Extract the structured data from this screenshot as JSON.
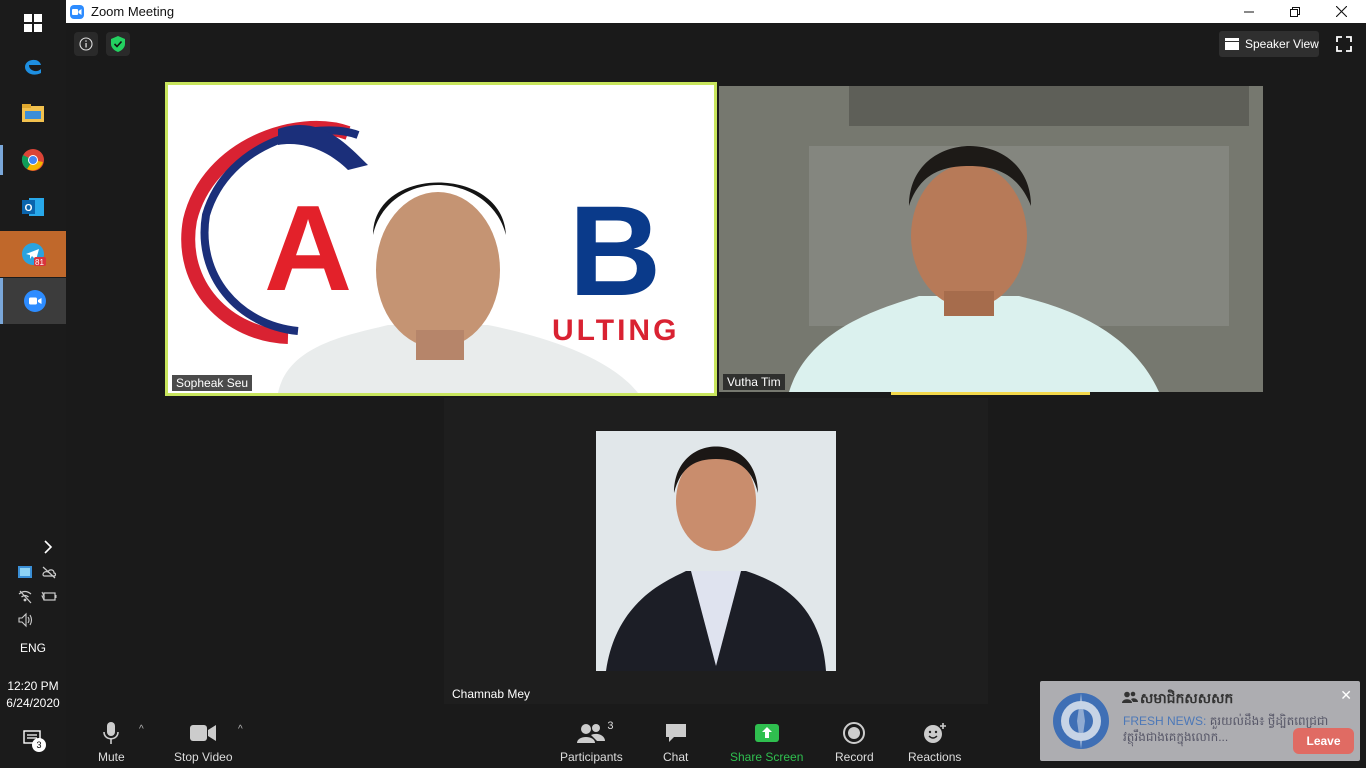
{
  "window": {
    "title": "Zoom Meeting"
  },
  "header": {
    "speaker_view_label": "Speaker View"
  },
  "participants": [
    {
      "name": "Sopheak Seu",
      "logo_text_a": "A",
      "logo_text_b": "B",
      "logo_tail": "ULTING"
    },
    {
      "name": "Vutha Tim"
    },
    {
      "name": "Chamnab Mey"
    }
  ],
  "toolbar": {
    "mute_label": "Mute",
    "stop_video_label": "Stop Video",
    "participants_label": "Participants",
    "participants_count": "3",
    "chat_label": "Chat",
    "share_screen_label": "Share Screen",
    "record_label": "Record",
    "reactions_label": "Reactions",
    "leave_label": "Leave"
  },
  "notification": {
    "title": "សមាជិកសសសក",
    "prefix": "FRESH NEWS:",
    "body": "គួរយល់ដឹង៖ ថ្វីដ្បិតពេជ្រជាវត្ថុរឹងជាងគេក្នុងលោក..."
  },
  "system_tray": {
    "language": "ENG",
    "time": "12:20 PM",
    "date": "6/24/2020",
    "notification_count": "3",
    "telegram_badge": "81"
  },
  "colors": {
    "active_speaker_border": "#c8e55d",
    "share_screen_green": "#2fbf4f",
    "leave_red": "#e06b63",
    "zoom_blue": "#2d8cff"
  }
}
